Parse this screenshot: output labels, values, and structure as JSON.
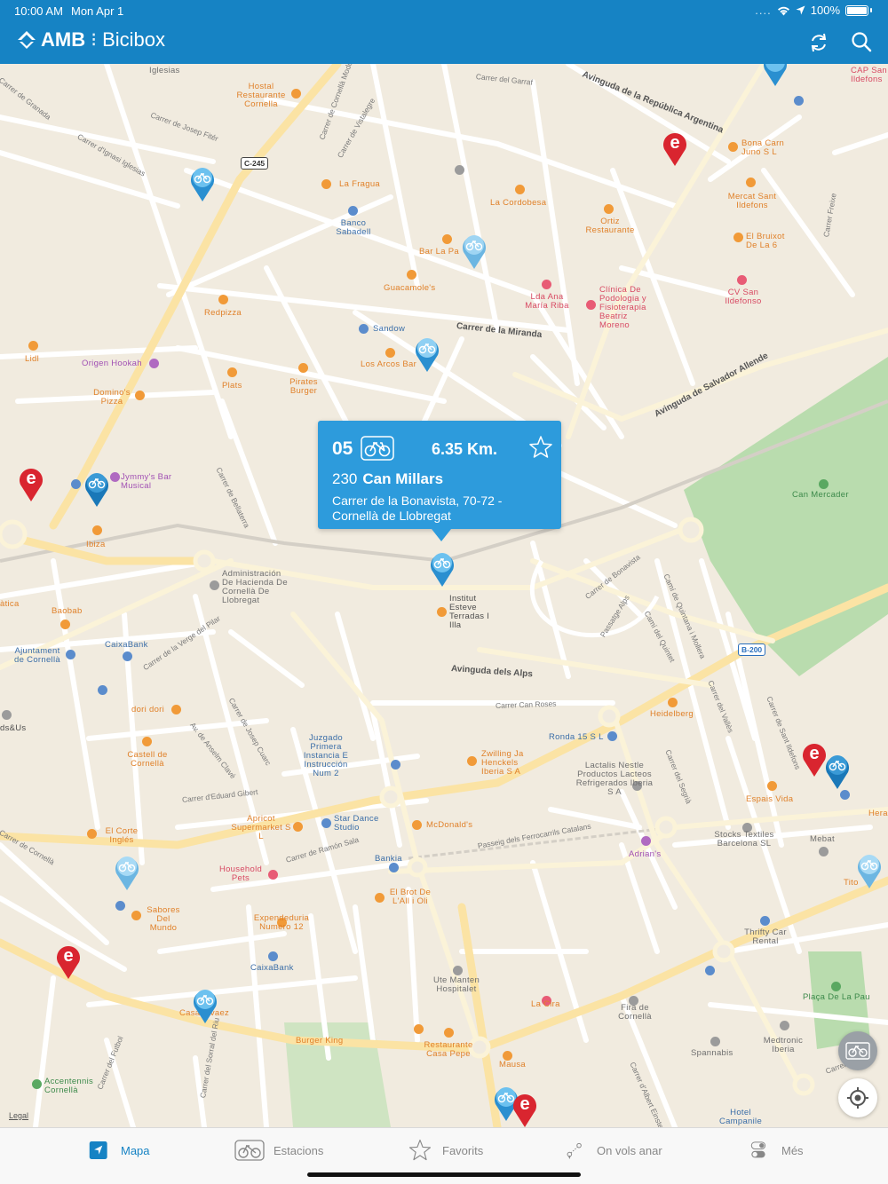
{
  "status_bar": {
    "time": "10:00 AM",
    "date": "Mon Apr 1",
    "signal": "....",
    "battery": "100%"
  },
  "header": {
    "brand": "AMB",
    "app_name": "Bicibox",
    "refresh_icon": "refresh-icon",
    "search_icon": "search-icon"
  },
  "colors": {
    "header_blue": "#1683c4",
    "callout_blue": "#2d9bdc",
    "pin_blue": "#2a8fd0",
    "pin_red": "#d9252f"
  },
  "callout": {
    "station_code": "05",
    "distance": "6.35 Km.",
    "station_number": "230",
    "station_name": "Can Millars",
    "address_line1": "Carrer de la Bonavista, 70-72 -",
    "address_line2": "Cornellà de Llobregat",
    "favorite_icon": "star-outline-icon"
  },
  "map": {
    "legal": "Legal",
    "shields": [
      "C-245",
      "B-200"
    ],
    "places": [
      {
        "text": "Iglesias",
        "color": "grey"
      },
      {
        "text": "Hostal Restaurante Cornella",
        "color": "orange"
      },
      {
        "text": "La Fragua",
        "color": "orange"
      },
      {
        "text": "Banco Sabadell",
        "color": "blue"
      },
      {
        "text": "La Cordobesa",
        "color": "orange"
      },
      {
        "text": "Ortiz Restaurante",
        "color": "orange"
      },
      {
        "text": "Bona Carn Juno S L",
        "color": "orange"
      },
      {
        "text": "Mercat Sant Ildefons",
        "color": "orange"
      },
      {
        "text": "El Bruixot De La 6",
        "color": "orange"
      },
      {
        "text": "CV San Ildefonso",
        "color": "pink"
      },
      {
        "text": "Clínica De Podologia y Fisioterapia Beatriz Moreno",
        "color": "pink"
      },
      {
        "text": "Lda Ana María Riba",
        "color": "pink"
      },
      {
        "text": "Bar La Pa",
        "color": "orange"
      },
      {
        "text": "Guacamole's",
        "color": "orange"
      },
      {
        "text": "Redpizza",
        "color": "orange"
      },
      {
        "text": "Sandow",
        "color": "blue"
      },
      {
        "text": "Lidl",
        "color": "orange"
      },
      {
        "text": "Origen Hookah",
        "color": "purple"
      },
      {
        "text": "Los Arcos Bar",
        "color": "orange"
      },
      {
        "text": "Plats",
        "color": "orange"
      },
      {
        "text": "Pirates Burger",
        "color": "orange"
      },
      {
        "text": "Domino's Pizza",
        "color": "orange"
      },
      {
        "text": "Jymmy's Bar Musical",
        "color": "purple"
      },
      {
        "text": "Ibiza",
        "color": "orange"
      },
      {
        "text": "Can Mercader",
        "color": "green"
      },
      {
        "text": "Administración De Hacienda De Cornellà De Llobregat",
        "color": "grey"
      },
      {
        "text": "Institut Esteve Terradas I Illa",
        "color": "dark"
      },
      {
        "text": "Baobab",
        "color": "orange"
      },
      {
        "text": "CaixaBank",
        "color": "blue"
      },
      {
        "text": "Ajuntament de Cornellà",
        "color": "blue"
      },
      {
        "text": "dori dori",
        "color": "orange"
      },
      {
        "text": "Castell de Cornellà",
        "color": "orange"
      },
      {
        "text": "Juzgado Primera Instancia E Instrucción Num 2",
        "color": "blue"
      },
      {
        "text": "Ronda 15 S L",
        "color": "blue"
      },
      {
        "text": "Heidelberg",
        "color": "orange"
      },
      {
        "text": "Zwilling Ja Henckels Iberia S A",
        "color": "orange"
      },
      {
        "text": "Lactalis Nestle Productos Lacteos Refrigerados Iberia S A",
        "color": "grey"
      },
      {
        "text": "Espais Vida",
        "color": "orange"
      },
      {
        "text": "El Corte Inglés",
        "color": "orange"
      },
      {
        "text": "Apricot Supermarket S L",
        "color": "orange"
      },
      {
        "text": "Star Dance Studio",
        "color": "blue"
      },
      {
        "text": "McDonald's",
        "color": "orange"
      },
      {
        "text": "Stocks Textiles Barcelona SL",
        "color": "grey"
      },
      {
        "text": "Mebat",
        "color": "grey"
      },
      {
        "text": "Adrian's",
        "color": "purple"
      },
      {
        "text": "Household Pets",
        "color": "pink"
      },
      {
        "text": "Bankia",
        "color": "blue"
      },
      {
        "text": "El Brot De L'All i Oli",
        "color": "orange"
      },
      {
        "text": "Sabores Del Mundo",
        "color": "orange"
      },
      {
        "text": "Expendeduria Numero 12",
        "color": "orange"
      },
      {
        "text": "CaixaBank",
        "color": "blue"
      },
      {
        "text": "Thrifty Car Rental",
        "color": "grey"
      },
      {
        "text": "Ute Manten Hospitalet",
        "color": "grey"
      },
      {
        "text": "La Cira",
        "color": "orange"
      },
      {
        "text": "Fira de Cornellà",
        "color": "grey"
      },
      {
        "text": "Plaça De La Pau",
        "color": "green"
      },
      {
        "text": "Casa Alvaez",
        "color": "orange"
      },
      {
        "text": "Burger King",
        "color": "orange"
      },
      {
        "text": "Restaurante Casa Pepe",
        "color": "orange"
      },
      {
        "text": "Mausa",
        "color": "orange"
      },
      {
        "text": "Medtronic Iberia",
        "color": "grey"
      },
      {
        "text": "Spannabis",
        "color": "grey"
      },
      {
        "text": "Accentennis Cornellà",
        "color": "green"
      },
      {
        "text": "Hotel Campanile",
        "color": "blue"
      },
      {
        "text": "CAP San Ildefons",
        "color": "pink"
      },
      {
        "text": "Tito",
        "color": "orange"
      },
      {
        "text": "Hera",
        "color": "orange"
      },
      {
        "text": "àtica",
        "color": "orange"
      },
      {
        "text": "ds&Us",
        "color": "dark"
      }
    ],
    "streets": [
      "Carrer de Granada",
      "Carrer del Garraf",
      "Avinguda de la República Argentina",
      "Carrer de Josep Fitér",
      "Carrer d'Ignasi Iglesias",
      "Carrer de Cornellà Modolell",
      "Carrer de Vistalegre",
      "Carrer de la Miranda",
      "Avinguda de Salvador Allende",
      "Carrer de Bellaterra",
      "Carrer de Bonavista",
      "Passatge Alps",
      "Camí del Quintet",
      "Camí de Quintana i Mollera",
      "Carrer de la Verge del Pilar",
      "Avinguda dels Alps",
      "Carrer Can Roses",
      "Carrer de Josep Cuarc",
      "Av. de Anselm Clavé",
      "Carrer d'Eduard Gibert",
      "Carrer de Ramón Sala",
      "Passeig dels Ferrocarrils Catalans",
      "Carrer del Segrià",
      "Carrer del Vallès",
      "Carrer de Sant Ildefons",
      "Carrer de Cornellà",
      "Carrer del Futbol",
      "Carrer del Sorral del Riu",
      "Carrer d'Albert Einstein",
      "Carrer Freixe",
      "Carrer de"
    ]
  },
  "fabs": {
    "bike_icon": "bike-filter-icon",
    "locate_icon": "locate-icon"
  },
  "tabs": [
    {
      "label": "Mapa",
      "icon": "map-arrow-icon",
      "active": true
    },
    {
      "label": "Estacions",
      "icon": "bike-icon",
      "active": false
    },
    {
      "label": "Favorits",
      "icon": "star-icon",
      "active": false
    },
    {
      "label": "On vols anar",
      "icon": "route-icon",
      "active": false
    },
    {
      "label": "Més",
      "icon": "toggles-icon",
      "active": false
    }
  ]
}
